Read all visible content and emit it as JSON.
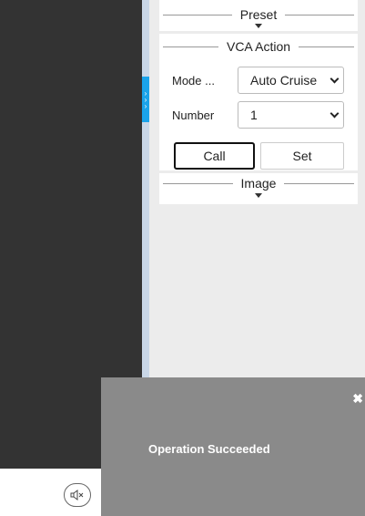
{
  "sections": {
    "preset": {
      "title": "Preset"
    },
    "vca_action": {
      "title": "VCA Action",
      "mode": {
        "label": "Mode ...",
        "value": "Auto Cruise"
      },
      "number": {
        "label": "Number",
        "value": "1"
      },
      "call_label": "Call",
      "set_label": "Set"
    },
    "image": {
      "title": "Image"
    }
  },
  "collapse_glyph": "›",
  "toast": {
    "message": "Operation Succeeded",
    "close_glyph": "✖"
  },
  "icons": {
    "mute": "speaker-mute-icon",
    "close": "close-icon",
    "collapse": "chevrons-right-icon"
  },
  "colors": {
    "video_bg": "#333333",
    "accent": "#1aa3ea",
    "toast_bg": "#8a8a8a"
  }
}
